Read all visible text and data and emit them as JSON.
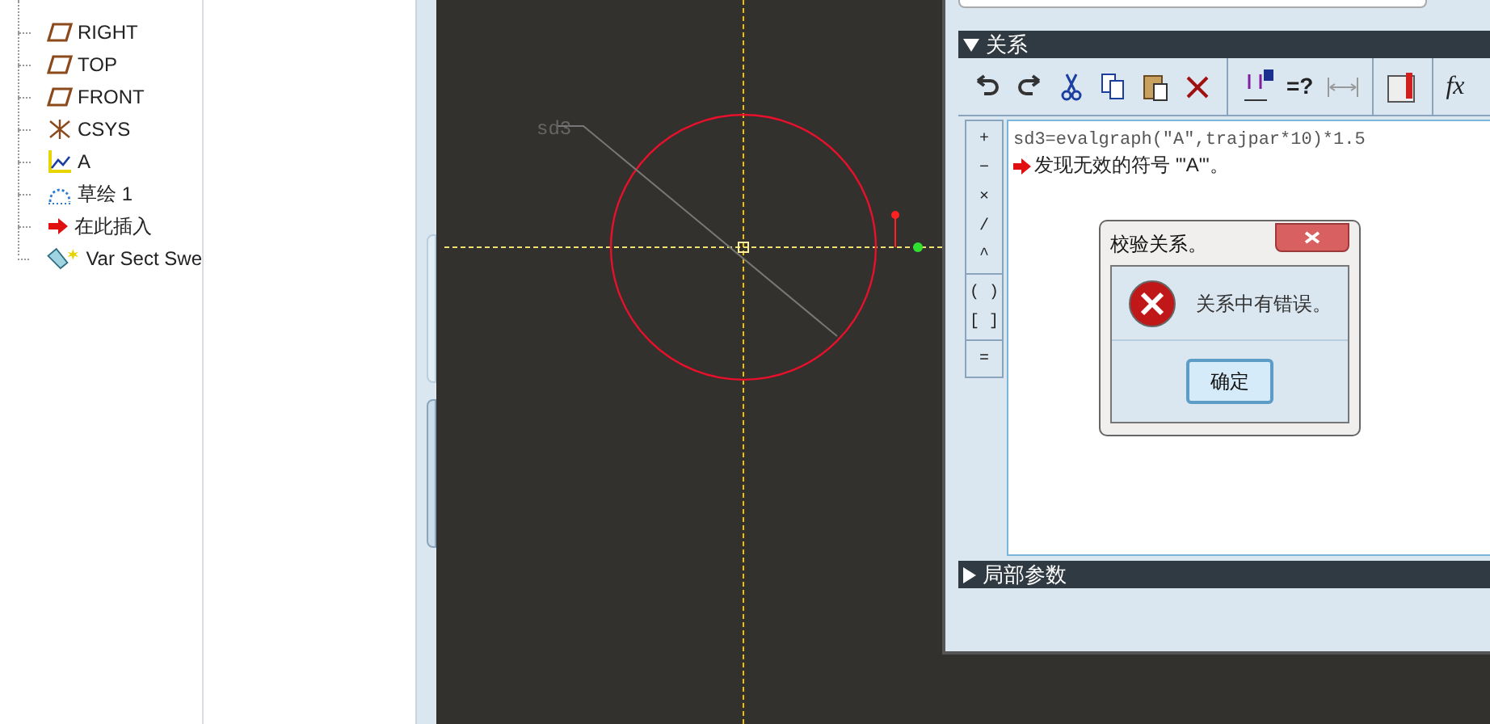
{
  "model_tree": {
    "items": [
      {
        "label": "RIGHT",
        "kind": "plane"
      },
      {
        "label": "TOP",
        "kind": "plane"
      },
      {
        "label": "FRONT",
        "kind": "plane"
      },
      {
        "label": "CSYS",
        "kind": "csys"
      },
      {
        "label": "A",
        "kind": "graph"
      },
      {
        "label": "草绘 1",
        "kind": "sketch"
      },
      {
        "label": "在此插入",
        "kind": "insert"
      },
      {
        "label": "Var Sect Swe",
        "kind": "sweep"
      }
    ]
  },
  "sketch": {
    "dimension_label": "sd3"
  },
  "relations_window": {
    "relations_header": {
      "title": "关系",
      "expanded": true
    },
    "toolbar": {
      "check_label": "=?",
      "function_label": "fx"
    },
    "operator_groups": [
      [
        "+",
        "−",
        "×",
        "/",
        "^"
      ],
      [
        "( )",
        "[ ]"
      ],
      [
        "="
      ]
    ],
    "editor": {
      "lines": [
        {
          "kind": "code",
          "text": "sd3=evalgraph(\"A\",trajpar*10)*1.5"
        },
        {
          "kind": "error",
          "text": "发现无效的符号 '\"A\"'。"
        }
      ]
    },
    "local_params_header": {
      "title": "局部参数",
      "expanded": false
    }
  },
  "dialog": {
    "title": "校验关系。",
    "message": "关系中有错误。",
    "button": "确定"
  }
}
